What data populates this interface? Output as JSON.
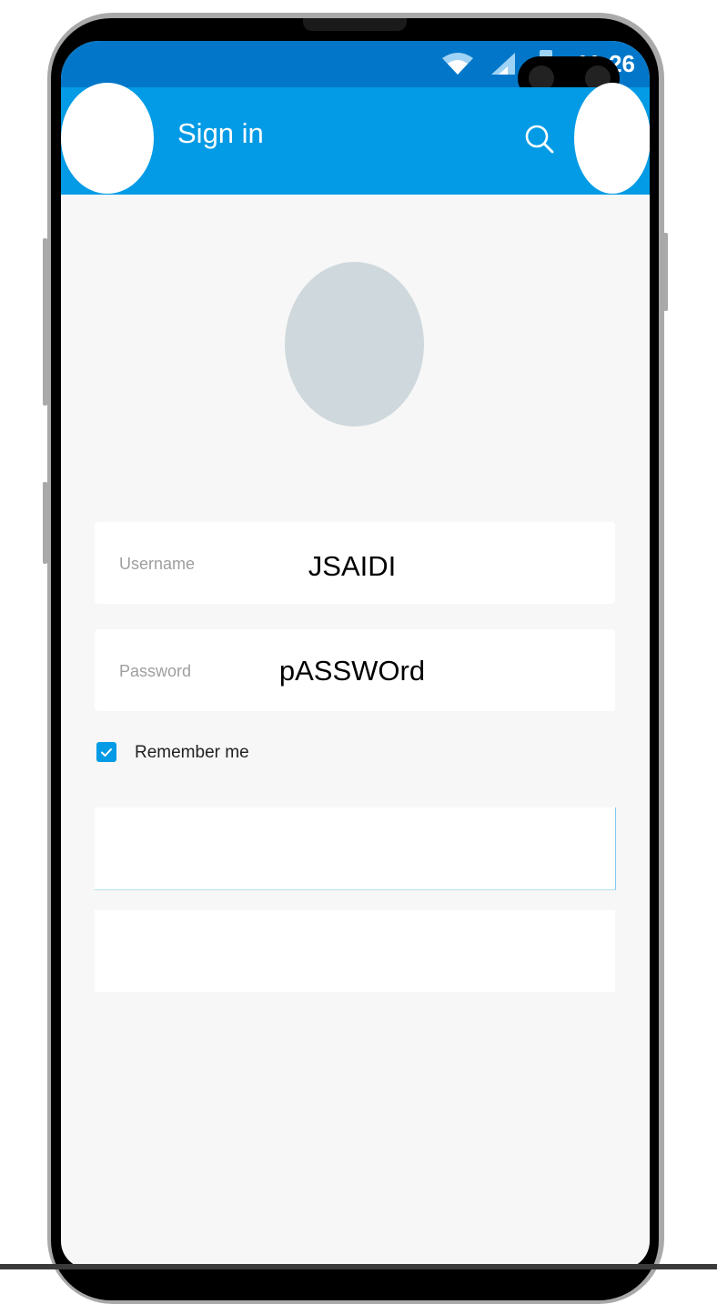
{
  "status_bar": {
    "time": "11:26"
  },
  "app_bar": {
    "title": "Sign in"
  },
  "form": {
    "username_label": "Username",
    "username_value": "JSAIDI",
    "password_label": "Password",
    "password_value": "pASSWOrd",
    "remember_label": "Remember me",
    "remember_checked": true
  },
  "colors": {
    "status_bar": "#0277c9",
    "app_bar": "#039be5",
    "accent": "#039be5",
    "avatar": "#cfd8dc",
    "screen_bg": "#f7f7f7"
  }
}
